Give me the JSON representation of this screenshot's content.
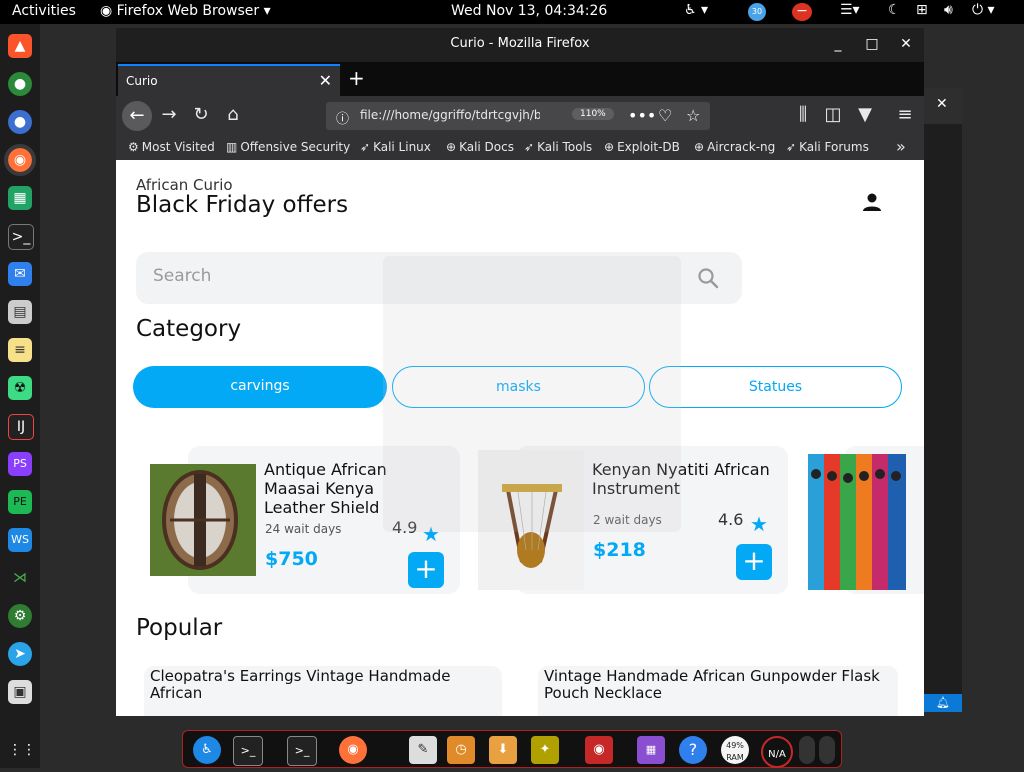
{
  "topbar": {
    "activities": "Activities",
    "app_name": "Firefox Web Browser",
    "clock": "Wed Nov 13, 04:34:26",
    "badge": "30"
  },
  "window": {
    "title": "Curio - Mozilla Firefox",
    "tab_label": "Curio",
    "url": "file:///home/ggriffo/tdrtcgvjh/bo",
    "zoom": "110%"
  },
  "bookmarks": [
    {
      "label": "Most Visited",
      "icon": "gear-icon"
    },
    {
      "label": "Offensive Security",
      "icon": "offsec-icon"
    },
    {
      "label": "Kali Linux",
      "icon": "kali-dragon-icon"
    },
    {
      "label": "Kali Docs",
      "icon": "globe-icon"
    },
    {
      "label": "Kali Tools",
      "icon": "kali-dragon-icon"
    },
    {
      "label": "Exploit-DB",
      "icon": "globe-icon"
    },
    {
      "label": "Aircrack-ng",
      "icon": "globe-icon"
    },
    {
      "label": "Kali Forums",
      "icon": "kali-dragon-icon"
    }
  ],
  "page": {
    "brand": "African Curio",
    "title": "Black Friday offers",
    "search_placeholder": "Search",
    "category_heading": "Category",
    "categories": [
      "carvings",
      "masks",
      "Statues"
    ],
    "popular_heading": "Popular",
    "products": [
      {
        "name": "Antique African Maasai Kenya Leather Shield",
        "wait": "24 wait days",
        "rating": "4.9",
        "price": "$750"
      },
      {
        "name": "Kenyan Nyatiti African Instrument",
        "wait": "2 wait days",
        "rating": "4.6",
        "price": "$218"
      }
    ],
    "popular": [
      {
        "name": "Cleopatra's Earrings Vintage Handmade African"
      },
      {
        "name": "Vintage Handmade African Gunpowder Flask Pouch Necklace"
      }
    ]
  },
  "taskbar": {
    "ram_label": "RAM",
    "ram_value": "49%",
    "net_label": "N/A"
  },
  "colors": {
    "accent": "#03a9f4",
    "firefox_toolbar": "#323234",
    "page_bg": "#ffffff"
  }
}
